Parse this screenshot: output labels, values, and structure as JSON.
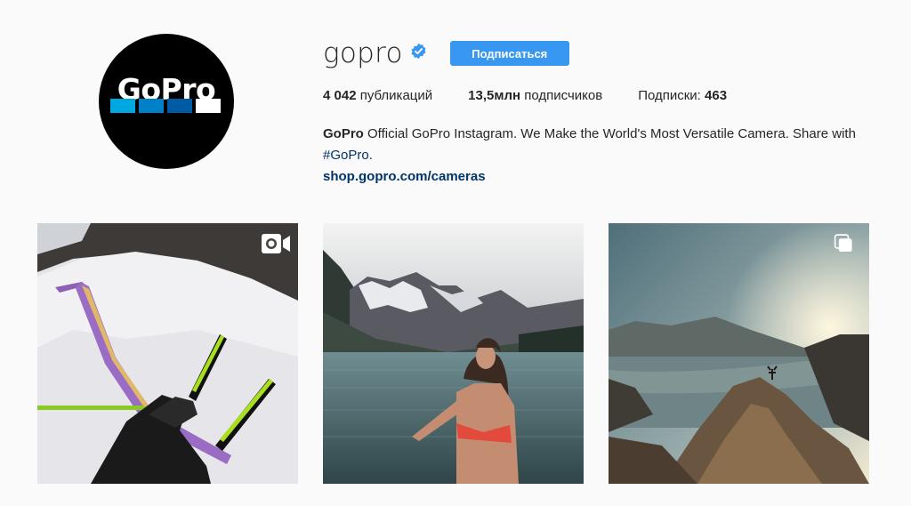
{
  "profile": {
    "username": "gopro",
    "follow_label": "Подписаться",
    "avatar_logo_text": "GoPro",
    "stats": {
      "posts_count": "4 042",
      "posts_label": "публикаций",
      "followers_count": "13,5млн",
      "followers_label": "подписчиков",
      "following_label": "Подписки:",
      "following_count": "463"
    },
    "bio": {
      "name": "GoPro",
      "text": "Official GoPro Instagram. We Make the World's Most Versatile Camera. Share with",
      "hashtag": "#GoPro",
      "after_hashtag": ".",
      "link": "shop.gopro.com/cameras"
    }
  },
  "posts": [
    {
      "type": "video",
      "icon": "video-camera-icon",
      "subject": "ski"
    },
    {
      "type": "photo",
      "icon": "",
      "subject": "lake"
    },
    {
      "type": "carousel",
      "icon": "carousel-icon",
      "subject": "mountain"
    }
  ],
  "colors": {
    "accent": "#3897f0",
    "link": "#003569",
    "verified": "#3897f0",
    "background": "#fafafa",
    "logo_blue_1": "#00a8e1",
    "logo_blue_2": "#0080c8",
    "logo_blue_3": "#005ba5"
  }
}
